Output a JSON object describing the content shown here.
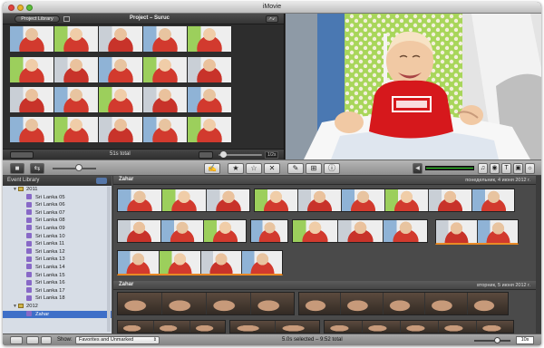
{
  "window": {
    "title": "iMovie"
  },
  "project": {
    "library_button": "Project Library",
    "title": "Project – Suruc",
    "fullscreen_label": "↗↙",
    "total": "51s total",
    "zoom_value": "1/2s"
  },
  "toolbar": {
    "buttons": [
      "add-clip",
      "favorite",
      "unmark",
      "reject",
      "keyword",
      "crop",
      "info"
    ]
  },
  "event_library": {
    "header": "Event Library",
    "items": [
      {
        "label": "2011",
        "kind": "year",
        "expanded": true
      },
      {
        "label": "Sri Lanka 05",
        "kind": "event"
      },
      {
        "label": "Sri Lanka 06",
        "kind": "event"
      },
      {
        "label": "Sri Lanka 07",
        "kind": "event"
      },
      {
        "label": "Sri Lanka 08",
        "kind": "event"
      },
      {
        "label": "Sri Lanka 09",
        "kind": "event"
      },
      {
        "label": "Sri Lanka 10",
        "kind": "event"
      },
      {
        "label": "Sri Lanka 11",
        "kind": "event"
      },
      {
        "label": "Sri Lanka 12",
        "kind": "event"
      },
      {
        "label": "Sri Lanka 13",
        "kind": "event"
      },
      {
        "label": "Sri Lanka 14",
        "kind": "event"
      },
      {
        "label": "Sri Lanka 15",
        "kind": "event"
      },
      {
        "label": "Sri Lanka 16",
        "kind": "event"
      },
      {
        "label": "Sri Lanka 17",
        "kind": "event"
      },
      {
        "label": "Sri Lanka 18",
        "kind": "event"
      },
      {
        "label": "2012",
        "kind": "year",
        "expanded": true
      },
      {
        "label": "Zahar",
        "kind": "event",
        "selected": true
      }
    ]
  },
  "events": [
    {
      "name": "Zahar",
      "date": "понедельник, 4 июня 2012 г."
    },
    {
      "name": "Zahar",
      "date": "вторник, 5 июня 2012 г."
    }
  ],
  "statusbar": {
    "show_label": "Show:",
    "filter_value": "Favorites and Unmarked",
    "selection_total": "5.0s selected – 9:52 total",
    "zoom_value": "10s"
  },
  "colors": {
    "accent_selection": "#3e6fc8",
    "rejected_bar": "#e98a25",
    "audio_meter": "#27d11c"
  }
}
